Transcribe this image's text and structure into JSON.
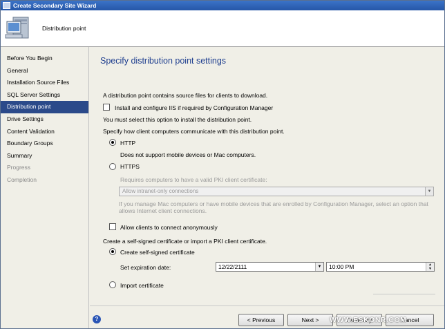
{
  "window": {
    "title": "Create Secondary Site Wizard"
  },
  "header": {
    "text": "Distribution point"
  },
  "nav": {
    "items": [
      {
        "label": "Before You Begin"
      },
      {
        "label": "General"
      },
      {
        "label": "Installation Source Files"
      },
      {
        "label": "SQL Server Settings"
      },
      {
        "label": "Distribution point"
      },
      {
        "label": "Drive Settings"
      },
      {
        "label": "Content Validation"
      },
      {
        "label": "Boundary Groups"
      },
      {
        "label": "Summary"
      },
      {
        "label": "Progress"
      },
      {
        "label": "Completion"
      }
    ],
    "active_index": 4
  },
  "content": {
    "title": "Specify distribution point settings",
    "intro": "A distribution point contains source files for clients to download.",
    "iis_label": "Install and configure IIS if required by Configuration Manager",
    "iis_checked": false,
    "iis_note": "You must select this option to install the distribution point.",
    "communicate": "Specify how client computers communicate with this distribution point.",
    "http_label": "HTTP",
    "http_checked": true,
    "http_note": "Does not support mobile devices or Mac computers.",
    "https_label": "HTTPS",
    "https_checked": false,
    "pki_note": "Requires computers to have a valid PKI client certificate:",
    "intranet_select": "Allow intranet-only connections",
    "mac_note_1": "If you manage Mac computers or have mobile devices that are enrolled by Configuration Manager, select an option that",
    "mac_note_2": "allows Internet client connections.",
    "anon_label": "Allow clients to connect anonymously",
    "anon_checked": false,
    "cert_prompt": "Create a self-signed certificate or import a PKI client certificate.",
    "self_signed_label": "Create self-signed certificate",
    "self_signed_checked": true,
    "expiration_label": "Set expiration date:",
    "expiration_date": "12/22/2111",
    "expiration_time": "10:00 PM",
    "import_label": "Import certificate",
    "import_checked": false
  },
  "footer": {
    "help": "?",
    "previous": "< Previous",
    "next": "Next >",
    "summary": "Summary",
    "cancel": "Cancel"
  },
  "watermark": "WWW.ESKONR.COM",
  "colors": {
    "accent": "#2b4a8a",
    "title": "#1f3f8f"
  }
}
